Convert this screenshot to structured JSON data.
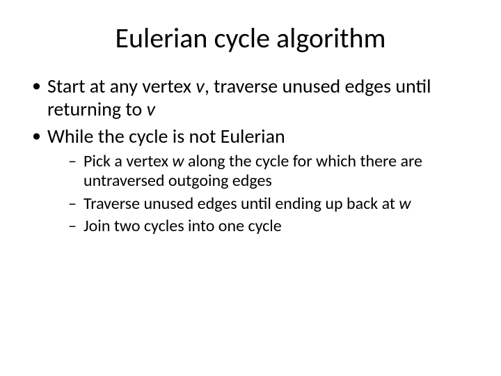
{
  "title": "Eulerian cycle algorithm",
  "bullets": {
    "b1": {
      "t1": "Start at any vertex ",
      "v1": "v",
      "t2": ", traverse unused edges until returning to ",
      "v2": "v"
    },
    "b2": "While the cycle is not Eulerian",
    "sub": {
      "s1": {
        "t1": "Pick a vertex ",
        "w": "w",
        "t2": " along the cycle for which there are untraversed outgoing edges"
      },
      "s2": {
        "t1": "Traverse unused edges until ending up back at ",
        "w": "w"
      },
      "s3": "Join two cycles into one cycle"
    }
  }
}
